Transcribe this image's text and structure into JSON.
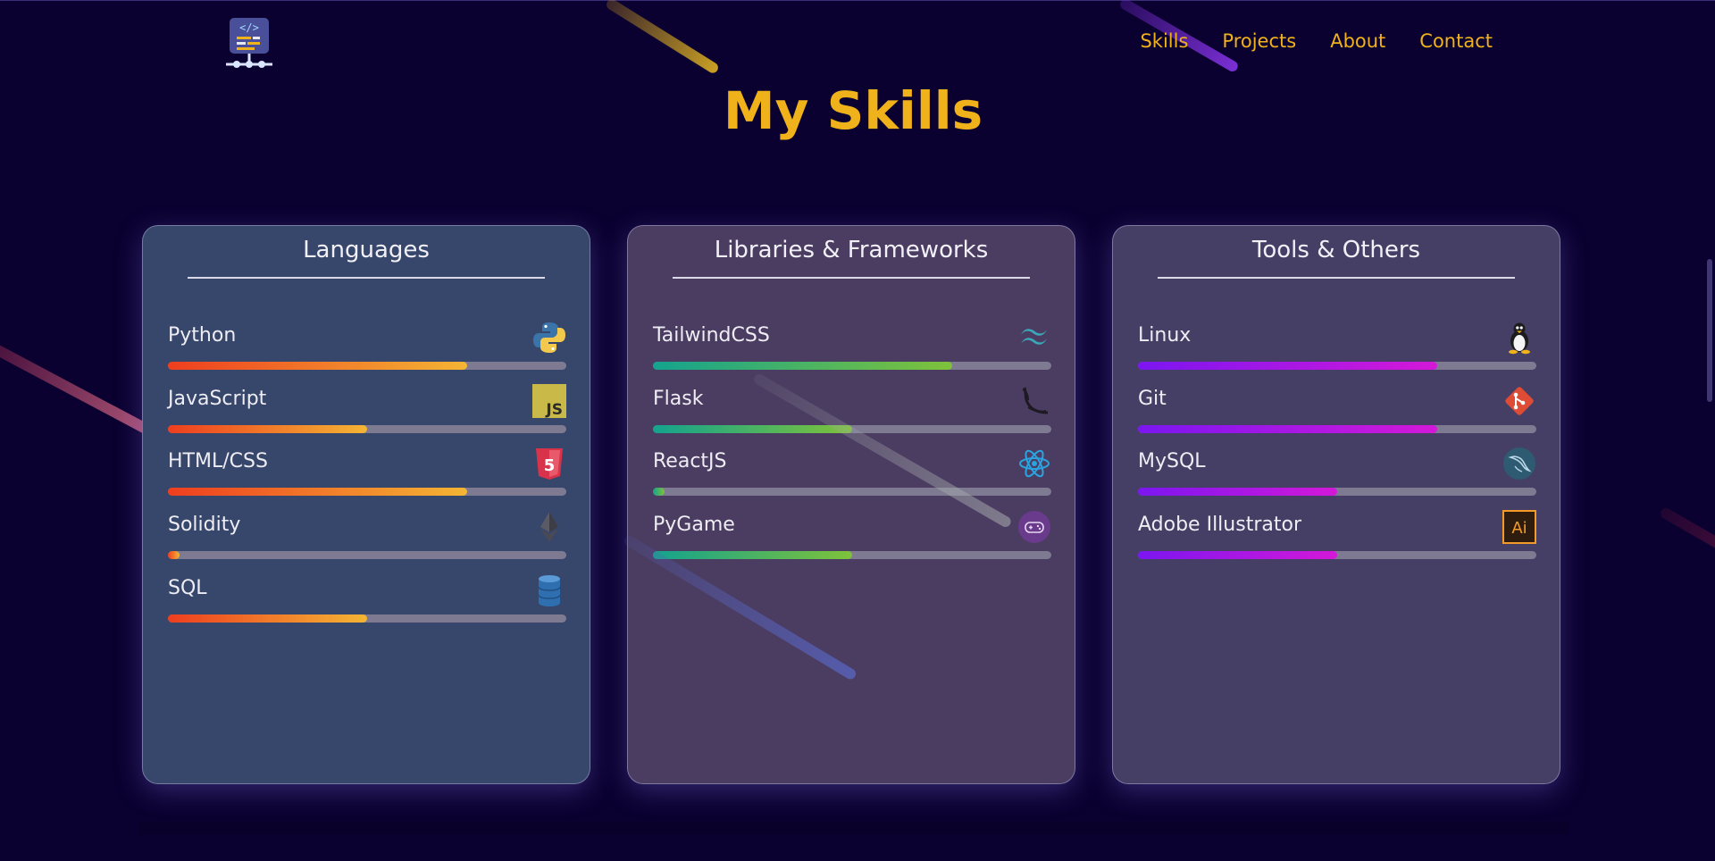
{
  "nav": {
    "logo": "code-logo-icon",
    "links": [
      "Skills",
      "Projects",
      "About",
      "Contact"
    ]
  },
  "page_title": "My Skills",
  "cards": [
    {
      "title": "Languages",
      "gradient": [
        "#ee3e1f",
        "#f4b534"
      ],
      "skills": [
        {
          "name": "Python",
          "level": 0.75,
          "icon": "python-icon"
        },
        {
          "name": "JavaScript",
          "level": 0.5,
          "icon": "javascript-icon"
        },
        {
          "name": "HTML/CSS",
          "level": 0.75,
          "icon": "html5-icon"
        },
        {
          "name": "Solidity",
          "level": 0.03,
          "icon": "ethereum-icon"
        },
        {
          "name": "SQL",
          "level": 0.5,
          "icon": "database-icon"
        }
      ]
    },
    {
      "title": "Libraries & Frameworks",
      "gradient": [
        "#14a38e",
        "#7fc23a"
      ],
      "skills": [
        {
          "name": "TailwindCSS",
          "level": 0.75,
          "icon": "tailwind-icon"
        },
        {
          "name": "Flask",
          "level": 0.5,
          "icon": "flask-icon"
        },
        {
          "name": "ReactJS",
          "level": 0.03,
          "icon": "react-icon"
        },
        {
          "name": "PyGame",
          "level": 0.5,
          "icon": "gamepad-icon"
        }
      ]
    },
    {
      "title": "Tools & Others",
      "gradient": [
        "#7b16f0",
        "#d418d8"
      ],
      "skills": [
        {
          "name": "Linux",
          "level": 0.75,
          "icon": "linux-tux-icon"
        },
        {
          "name": "Git",
          "level": 0.75,
          "icon": "git-icon"
        },
        {
          "name": "MySQL",
          "level": 0.5,
          "icon": "mysql-dolphin-icon"
        },
        {
          "name": "Adobe Illustrator",
          "level": 0.5,
          "icon": "illustrator-icon"
        }
      ]
    }
  ],
  "accent_color": "#f0b21a",
  "background_color": "#0b0130"
}
